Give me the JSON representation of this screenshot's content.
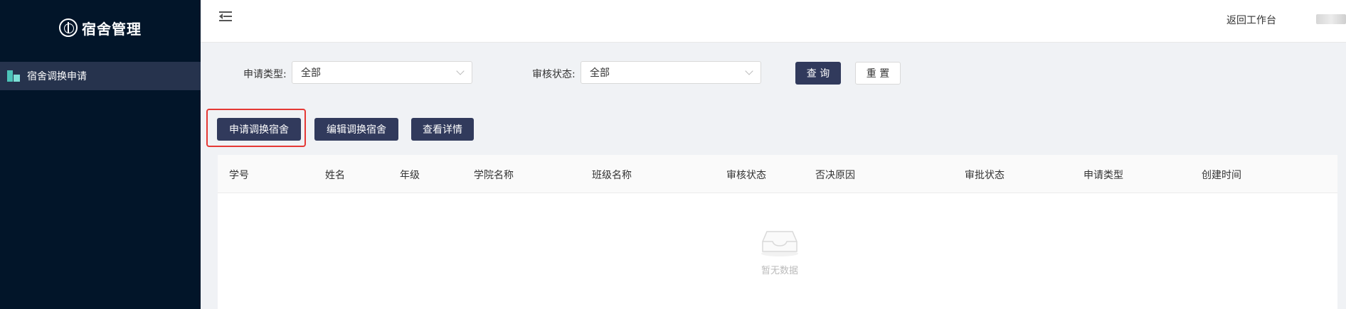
{
  "sidebar": {
    "logo_title": "宿舍管理",
    "menu": [
      {
        "label": "宿舍调换申请",
        "active": true
      }
    ]
  },
  "header": {
    "back_label": "返回工作台"
  },
  "filters": {
    "type_label": "申请类型:",
    "type_value": "全部",
    "status_label": "审核状态:",
    "status_value": "全部",
    "query_label": "查 询",
    "reset_label": "重 置"
  },
  "actions": {
    "apply_label": "申请调换宿舍",
    "edit_label": "编辑调换宿舍",
    "detail_label": "查看详情"
  },
  "table": {
    "columns": [
      "学号",
      "姓名",
      "年级",
      "学院名称",
      "班级名称",
      "审核状态",
      "否决原因",
      "审批状态",
      "申请类型",
      "创建时间"
    ],
    "rows": [],
    "empty_text": "暂无数据"
  },
  "colors": {
    "sidebar_bg": "#021529",
    "menu_active_bg": "#26334d",
    "primary_button": "#313a5c",
    "highlight": "#e53935"
  }
}
